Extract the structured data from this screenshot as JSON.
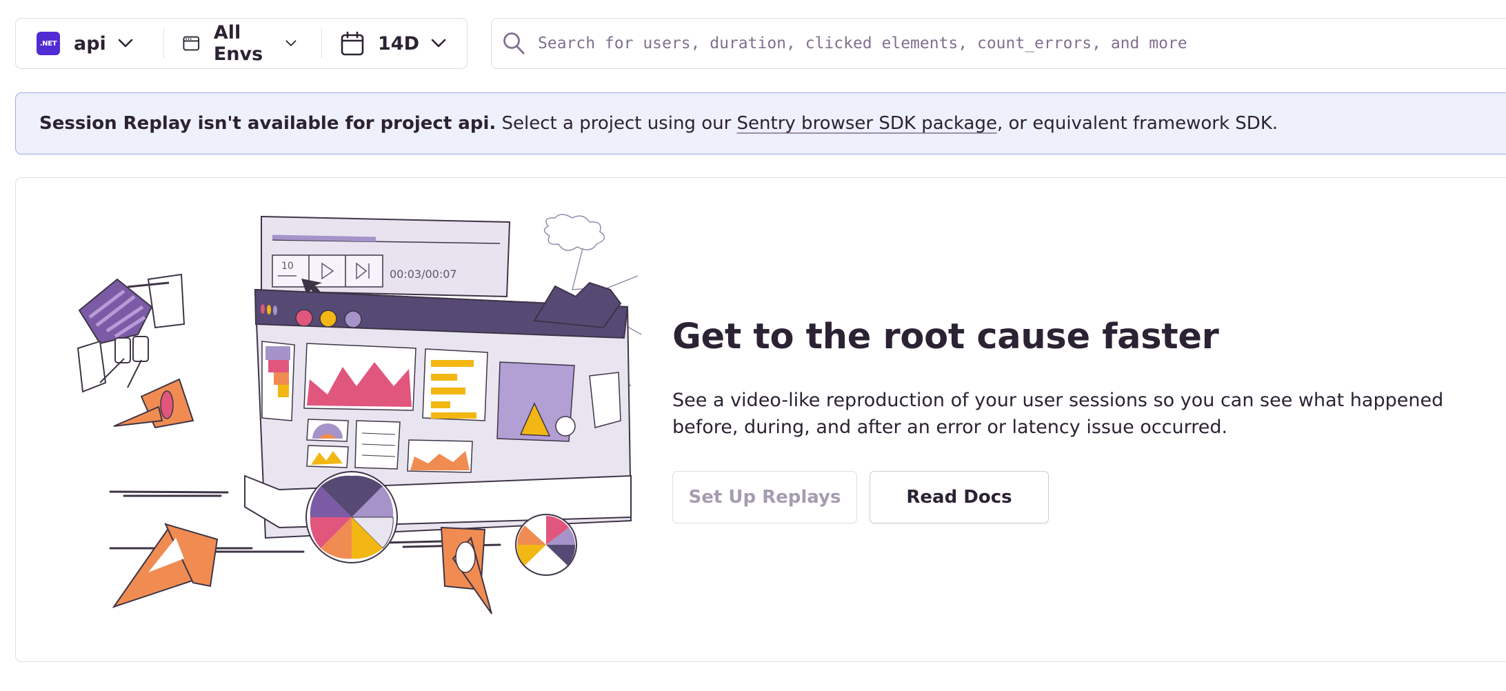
{
  "filters": {
    "project": {
      "badge": ".NET",
      "label": "api",
      "icon": "dotnet-icon"
    },
    "environment": {
      "label": "All Envs",
      "icon": "browser-window-icon"
    },
    "date_range": {
      "label": "14D",
      "icon": "calendar-icon"
    }
  },
  "search": {
    "placeholder": "Search for users, duration, clicked elements, count_errors, and more",
    "value": "",
    "icon": "search-icon"
  },
  "alert": {
    "bold": "Session Replay isn't available for project api.",
    "text_before_link": " Select a project using our ",
    "link": "Sentry browser SDK package",
    "text_after_link": ", or equivalent framework SDK."
  },
  "empty_state": {
    "title": "Get to the root cause faster",
    "description": "See a video-like reproduction of your user sessions so you can see what happened before, during, and after an error or latency issue occurred.",
    "primary_button": "Set Up Replays",
    "secondary_button": "Read Docs",
    "player": {
      "rewind_label": "10",
      "time": "00:03/00:07",
      "progress": 0.43
    }
  },
  "colors": {
    "accent_purple": "#564a75",
    "light_purple": "#a593c9",
    "pink": "#e1567c",
    "orange": "#f08c52",
    "yellow": "#f2b712",
    "alert_bg": "#eef0fb",
    "alert_border": "#9eaae8"
  }
}
